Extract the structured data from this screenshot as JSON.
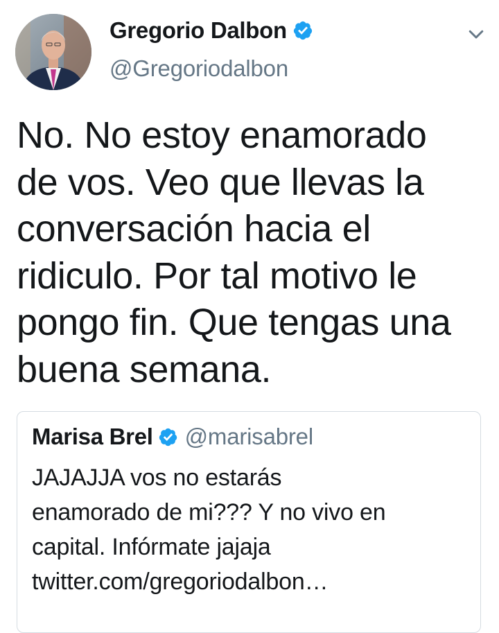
{
  "tweet": {
    "author": {
      "name": "Gregorio Dalbon",
      "handle": "@Gregoriodalbon",
      "verified": true,
      "avatar_icon": "profile-photo"
    },
    "menu_icon": "chevron-down-icon",
    "text": "No. No estoy enamorado\nde vos. Veo que llevas la\nconversación hacia el\nridiculo. Por tal motivo le\npongo fin. Que tengas una\nbuena semana."
  },
  "quoted_tweet": {
    "author": {
      "name": "Marisa Brel",
      "handle": "@marisabrel",
      "verified": true
    },
    "text": "JAJAJJA vos no estarás\nenamorado de mi??? Y no vivo en\ncapital.  Infórmate jajaja\ntwitter.com/gregoriodalbon…"
  },
  "colors": {
    "text_primary": "#14171a",
    "text_secondary": "#657786",
    "verified_blue": "#1da1f2",
    "border": "#d4dbe1"
  }
}
